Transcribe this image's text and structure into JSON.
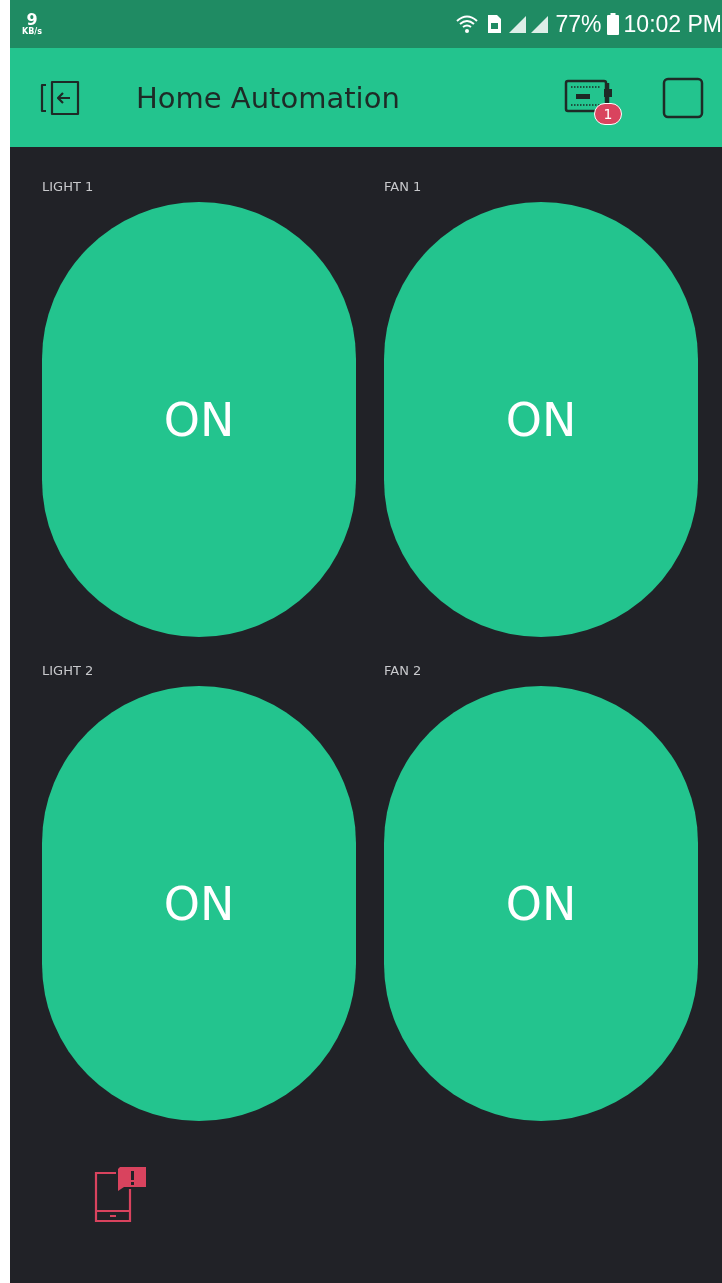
{
  "status_bar": {
    "speed_value": "9",
    "speed_unit": "KB/s",
    "battery": "77%",
    "time": "10:02 PM"
  },
  "header": {
    "title": "Home Automation",
    "device_badge": "1"
  },
  "widgets": [
    {
      "label": "LIGHT 1",
      "button_text": "ON"
    },
    {
      "label": "FAN 1",
      "button_text": "ON"
    },
    {
      "label": "LIGHT 2",
      "button_text": "ON"
    },
    {
      "label": "FAN 2",
      "button_text": "ON"
    }
  ]
}
